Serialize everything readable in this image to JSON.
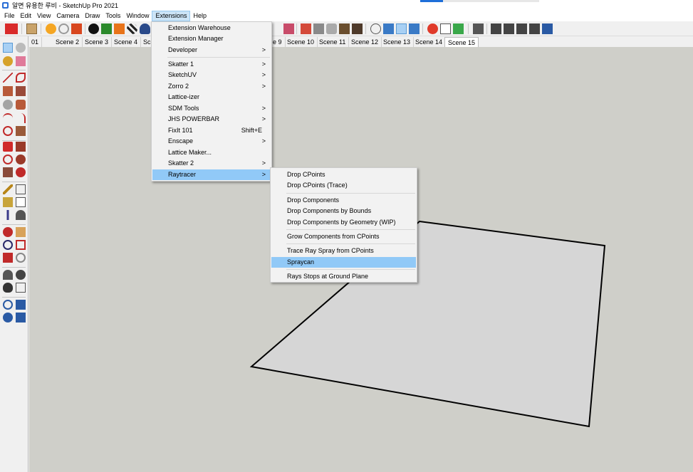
{
  "window": {
    "title": "알면 유용한 루비 - SketchUp Pro 2021"
  },
  "menubar": {
    "items": [
      "File",
      "Edit",
      "View",
      "Camera",
      "Draw",
      "Tools",
      "Window",
      "Extensions",
      "Help"
    ],
    "active": "Extensions"
  },
  "scenes": {
    "tabs": [
      "01",
      "Scene 2",
      "Scene 3",
      "Scene 4",
      "Sc",
      "e 9",
      "Scene 10",
      "Scene 11",
      "Scene 12",
      "Scene 13",
      "Scene 14",
      "Scene 15"
    ],
    "active": "Scene 15"
  },
  "extensions_menu": {
    "items": [
      {
        "label": "Extension Warehouse",
        "submenu": false
      },
      {
        "label": "Extension Manager",
        "submenu": false
      },
      {
        "label": "Developer",
        "submenu": true
      },
      {
        "label": "Skatter 1",
        "submenu": true
      },
      {
        "label": "SketchUV",
        "submenu": true
      },
      {
        "label": "Zorro 2",
        "submenu": true
      },
      {
        "label": "Lattice-izer",
        "submenu": false
      },
      {
        "label": "SDM Tools",
        "submenu": true
      },
      {
        "label": "JHS POWERBAR",
        "submenu": true
      },
      {
        "label": "FixIt 101",
        "submenu": false,
        "shortcut": "Shift+E"
      },
      {
        "label": "Enscape",
        "submenu": true
      },
      {
        "label": "Lattice Maker...",
        "submenu": false
      },
      {
        "label": "Skatter 2",
        "submenu": true
      },
      {
        "label": "Raytracer",
        "submenu": true,
        "highlight": true
      }
    ],
    "arrow_glyph": ">"
  },
  "raytracer_submenu": {
    "items": [
      {
        "label": "Drop CPoints"
      },
      {
        "label": "Drop CPoints (Trace)"
      },
      {
        "label": "Drop Components"
      },
      {
        "label": "Drop Components by Bounds"
      },
      {
        "label": "Drop Components by Geometry (WIP)"
      },
      {
        "label": "Grow Components from CPoints"
      },
      {
        "label": "Trace Ray Spray from CPoints"
      },
      {
        "label": "Spraycan",
        "highlight": true
      },
      {
        "label": "Rays Stops at Ground Plane"
      }
    ]
  },
  "colors": {
    "viewport_bg": "#cfcfc9",
    "highlight": "#91c9f7",
    "face_fill": "#d6d6d6",
    "edge": "#000000"
  }
}
